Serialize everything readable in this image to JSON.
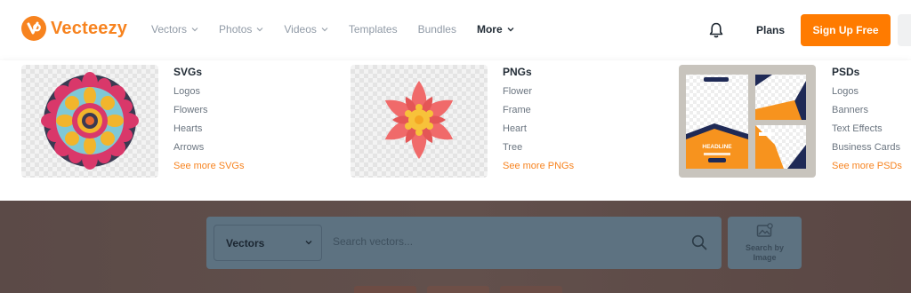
{
  "brand": {
    "name": "Vecteezy",
    "color": "#f7831f"
  },
  "nav": {
    "items": [
      {
        "label": "Vectors",
        "has_dropdown": true
      },
      {
        "label": "Photos",
        "has_dropdown": true
      },
      {
        "label": "Videos",
        "has_dropdown": true
      },
      {
        "label": "Templates",
        "has_dropdown": false
      },
      {
        "label": "Bundles",
        "has_dropdown": false
      },
      {
        "label": "More",
        "has_dropdown": true,
        "active": true
      }
    ],
    "icons": {
      "notifications": "bell-icon"
    },
    "plans_label": "Plans",
    "signup_label": "Sign Up Free",
    "signup_color": "#ff7b00"
  },
  "mega_menu": {
    "columns": [
      {
        "title": "SVGs",
        "thumbnail": "mandala-svg-preview",
        "links": [
          "Logos",
          "Flowers",
          "Hearts",
          "Arrows"
        ],
        "more": "See more SVGs"
      },
      {
        "title": "PNGs",
        "thumbnail": "flower-png-preview",
        "links": [
          "Flower",
          "Frame",
          "Heart",
          "Tree"
        ],
        "more": "See more PNGs"
      },
      {
        "title": "PSDs",
        "thumbnail": "social-post-templates-preview",
        "links": [
          "Logos",
          "Banners",
          "Text Effects",
          "Business Cards"
        ],
        "more": "See more PSDs"
      }
    ],
    "psd_preview_text": {
      "headline": "HEADLINE"
    }
  },
  "search": {
    "category": "Vectors",
    "placeholder": "Search vectors...",
    "search_icon": "search-icon",
    "image_search_label": "Search by Image",
    "image_search_icon": "image-search-icon"
  }
}
